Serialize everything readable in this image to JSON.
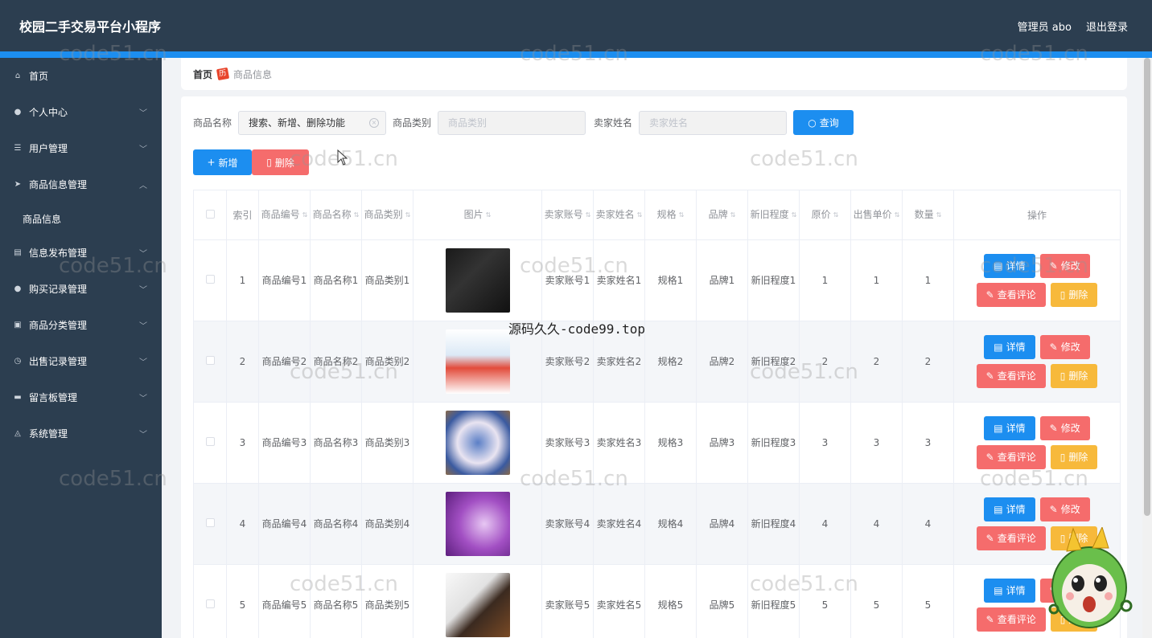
{
  "app": {
    "title": "校园二手交易平台小程序",
    "user_label": "管理员 abo",
    "logout": "退出登录"
  },
  "sidebar": {
    "items": [
      {
        "label": "首页",
        "icon": "home-icon",
        "arrow": ""
      },
      {
        "label": "个人中心",
        "icon": "user-icon",
        "arrow": "﹀"
      },
      {
        "label": "用户管理",
        "icon": "sliders-icon",
        "arrow": "﹀"
      },
      {
        "label": "商品信息管理",
        "icon": "send-icon",
        "arrow": "︿"
      },
      {
        "label": "商品信息",
        "icon": "",
        "arrow": "",
        "sub": true
      },
      {
        "label": "信息发布管理",
        "icon": "doc-icon",
        "arrow": "﹀"
      },
      {
        "label": "购买记录管理",
        "icon": "user-icon",
        "arrow": "﹀"
      },
      {
        "label": "商品分类管理",
        "icon": "clipboard-icon",
        "arrow": "﹀"
      },
      {
        "label": "出售记录管理",
        "icon": "clock-icon",
        "arrow": "﹀"
      },
      {
        "label": "留言板管理",
        "icon": "monitor-icon",
        "arrow": "﹀"
      },
      {
        "label": "系统管理",
        "icon": "bell-icon",
        "arrow": "﹀"
      }
    ]
  },
  "breadcrumb": {
    "home": "首页",
    "sep_icon": "fire-icon",
    "sep_text": "历",
    "current": "商品信息"
  },
  "search": {
    "name_label": "商品名称",
    "name_value": "搜索、新增、删除功能",
    "category_label": "商品类别",
    "category_placeholder": "商品类别",
    "seller_label": "卖家姓名",
    "seller_placeholder": "卖家姓名",
    "query_button": "查询"
  },
  "actions": {
    "add": "新增",
    "delete": "删除"
  },
  "table": {
    "headers": [
      "索引",
      "商品编号",
      "商品名称",
      "商品类别",
      "图片",
      "卖家账号",
      "卖家姓名",
      "规格",
      "品牌",
      "新旧程度",
      "原价",
      "出售单价",
      "数量",
      "操作"
    ],
    "rows": [
      {
        "index": "1",
        "code": "商品编号1",
        "name": "商品名称1",
        "cat": "商品类别1",
        "acct": "卖家账号1",
        "seller": "卖家姓名1",
        "spec": "规格1",
        "brand": "品牌1",
        "cond": "新旧程度1",
        "orig": "1",
        "price": "1",
        "qty": "1"
      },
      {
        "index": "2",
        "code": "商品编号2",
        "name": "商品名称2",
        "cat": "商品类别2",
        "acct": "卖家账号2",
        "seller": "卖家姓名2",
        "spec": "规格2",
        "brand": "品牌2",
        "cond": "新旧程度2",
        "orig": "2",
        "price": "2",
        "qty": "2"
      },
      {
        "index": "3",
        "code": "商品编号3",
        "name": "商品名称3",
        "cat": "商品类别3",
        "acct": "卖家账号3",
        "seller": "卖家姓名3",
        "spec": "规格3",
        "brand": "品牌3",
        "cond": "新旧程度3",
        "orig": "3",
        "price": "3",
        "qty": "3"
      },
      {
        "index": "4",
        "code": "商品编号4",
        "name": "商品名称4",
        "cat": "商品类别4",
        "acct": "卖家账号4",
        "seller": "卖家姓名4",
        "spec": "规格4",
        "brand": "品牌4",
        "cond": "新旧程度4",
        "orig": "4",
        "price": "4",
        "qty": "4"
      },
      {
        "index": "5",
        "code": "商品编号5",
        "name": "商品名称5",
        "cat": "商品类别5",
        "acct": "卖家账号5",
        "seller": "卖家姓名5",
        "spec": "规格5",
        "brand": "品牌5",
        "cond": "新旧程度5",
        "orig": "5",
        "price": "5",
        "qty": "5"
      }
    ],
    "row_buttons": {
      "detail": "详情",
      "edit": "修改",
      "comments": "查看评论",
      "delete": "删除"
    }
  },
  "overlay": {
    "watermark": "code51.cn",
    "caption": "源码久久-code99.top"
  },
  "colors": {
    "header": "#2c3e50",
    "primary": "#1c8ef0",
    "danger": "#f56c6c",
    "warning": "#f7b93b"
  }
}
